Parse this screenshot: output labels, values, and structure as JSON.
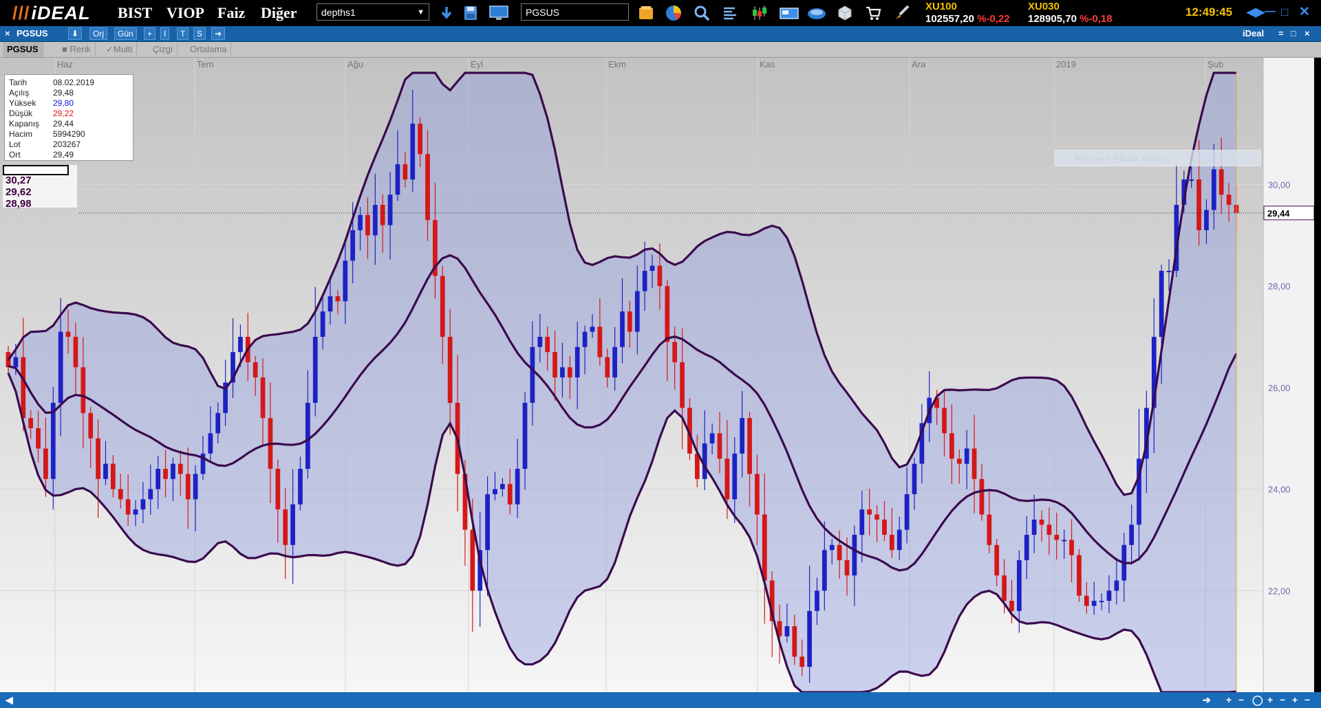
{
  "app": {
    "logo": "iDEAL",
    "menu": [
      "BIST",
      "VIOP",
      "Faiz",
      "Diğer"
    ],
    "page_input": "depths1",
    "symbol_input": "PGSUS",
    "clock": "12:49:45",
    "indices": [
      {
        "name": "XU100",
        "value": "102557,20",
        "change": "%-0,22"
      },
      {
        "name": "XU030",
        "value": "128905,70",
        "change": "%-0,18"
      }
    ],
    "toolbar_icons": [
      "download-icon",
      "save-icon",
      "monitor-icon",
      "folder-icon",
      "pie-chart-icon",
      "search-icon",
      "list-icon",
      "candles-icon",
      "news-icon",
      "portfolio-icon",
      "cube-icon",
      "cart-icon",
      "brush-icon"
    ]
  },
  "window": {
    "title_items": [
      "×",
      "PGSUS",
      "Orj",
      "Gün",
      "+",
      "I",
      "T",
      "S"
    ],
    "brand": "iDeal",
    "controls": [
      "=",
      "□",
      "×"
    ]
  },
  "chart_toolbar": {
    "symbol": "PGSUS",
    "items": [
      "■ Renk",
      "✓Multi",
      "Çizgi",
      "Ortalama"
    ]
  },
  "info_panel": {
    "rows": [
      {
        "label": "Tarih",
        "value": "08.02.2019",
        "color": "#222222"
      },
      {
        "label": "Açılış",
        "value": "29,48",
        "color": "#222222"
      },
      {
        "label": "Yüksek",
        "value": "29,80",
        "color": "#1010e0"
      },
      {
        "label": "Düşük",
        "value": "29,22",
        "color": "#e01010"
      },
      {
        "label": "Kapanış",
        "value": "29,44",
        "color": "#222222"
      },
      {
        "label": "Hacim",
        "value": "5994290",
        "color": "#222222"
      },
      {
        "label": "Lot",
        "value": "203267",
        "color": "#222222"
      },
      {
        "label": "Ort",
        "value": "29,49",
        "color": "#222222"
      }
    ]
  },
  "band_values": [
    "30,27",
    "29,62",
    "28,98"
  ],
  "watermark": "Pencere Ekran Alıntısı",
  "chart_data": {
    "type": "candlestick",
    "x_ticks": [
      "Haz",
      "Tem",
      "Ağu",
      "Eyl",
      "Ekm",
      "Kas",
      "Ara",
      "2019",
      "Şub"
    ],
    "y_ticks": [
      "22,00",
      "24,00",
      "26,00",
      "28,00",
      "30,00"
    ],
    "ylim": [
      20.0,
      32.2
    ],
    "last_price": 29.44,
    "last_price_label": "29,44",
    "colors": {
      "up": "#1c22c4",
      "down": "#d41818",
      "band_line": "#3a0a4e",
      "band_fill": "#8e9bde"
    },
    "closes": [
      26.4,
      26.6,
      25.4,
      25.2,
      24.8,
      24.2,
      25.7,
      27.1,
      27.0,
      26.4,
      25.5,
      25.0,
      24.2,
      24.5,
      24.0,
      23.8,
      23.5,
      23.6,
      23.8,
      24.0,
      24.4,
      24.2,
      24.5,
      24.3,
      23.8,
      24.3,
      24.7,
      25.1,
      25.5,
      26.1,
      26.7,
      27.0,
      26.5,
      26.2,
      25.4,
      24.4,
      23.6,
      22.9,
      23.7,
      24.4,
      25.7,
      27.0,
      27.5,
      27.8,
      27.7,
      28.5,
      29.1,
      29.4,
      29.0,
      29.6,
      29.2,
      29.8,
      30.4,
      30.1,
      31.2,
      30.6,
      29.3,
      28.2,
      27.0,
      25.7,
      24.3,
      23.2,
      22.0,
      22.8,
      23.9,
      24.0,
      24.1,
      23.7,
      24.4,
      25.7,
      26.8,
      27.0,
      26.7,
      26.2,
      26.4,
      26.2,
      26.8,
      27.1,
      27.2,
      26.6,
      26.2,
      26.8,
      27.5,
      27.1,
      27.9,
      28.3,
      28.4,
      28.0,
      26.9,
      26.5,
      25.6,
      24.7,
      24.2,
      24.9,
      25.1,
      24.6,
      23.8,
      24.7,
      25.4,
      24.3,
      23.5,
      22.2,
      21.4,
      21.1,
      21.3,
      20.7,
      20.5,
      21.6,
      22.0,
      22.8,
      22.9,
      22.6,
      22.3,
      23.1,
      23.6,
      23.5,
      23.4,
      23.1,
      22.8,
      23.2,
      23.9,
      24.5,
      25.3,
      25.8,
      25.6,
      25.1,
      24.6,
      24.5,
      24.8,
      24.2,
      23.5,
      22.9,
      22.3,
      21.8,
      21.6,
      22.6,
      23.1,
      23.4,
      23.3,
      23.1,
      23.0,
      23.0,
      22.7,
      21.9,
      21.7,
      21.8,
      21.8,
      22.0,
      22.2,
      22.9,
      23.3,
      24.6,
      25.6,
      27.0,
      28.3,
      28.3,
      29.6,
      30.1,
      30.1,
      29.1,
      29.5,
      30.3,
      29.8,
      29.6,
      29.44
    ]
  }
}
